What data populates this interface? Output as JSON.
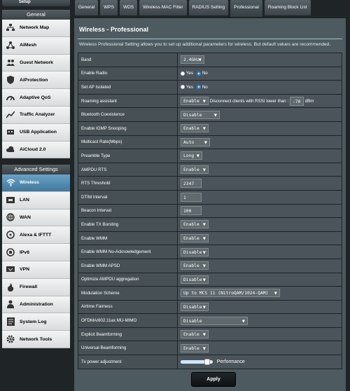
{
  "sidebar": {
    "top_button": "Setup",
    "general_header": "General",
    "general_items": [
      {
        "label": "Network Map",
        "icon": "network-map-icon"
      },
      {
        "label": "AiMesh",
        "icon": "aimesh-icon"
      },
      {
        "label": "Guest Network",
        "icon": "guest-network-icon"
      },
      {
        "label": "AiProtection",
        "icon": "shield-icon"
      },
      {
        "label": "Adaptive QoS",
        "icon": "qos-gauge-icon"
      },
      {
        "label": "Traffic Analyzer",
        "icon": "traffic-chart-icon"
      },
      {
        "label": "USB Application",
        "icon": "usb-icon"
      },
      {
        "label": "AiCloud 2.0",
        "icon": "cloud-icon"
      }
    ],
    "advanced_header": "Advanced Settings",
    "advanced_items": [
      {
        "label": "Wireless",
        "icon": "wifi-icon",
        "active": true
      },
      {
        "label": "LAN",
        "icon": "lan-icon"
      },
      {
        "label": "WAN",
        "icon": "globe-icon"
      },
      {
        "label": "Alexa & IFTTT",
        "icon": "alexa-icon"
      },
      {
        "label": "IPv6",
        "icon": "ipv6-icon"
      },
      {
        "label": "VPN",
        "icon": "vpn-icon"
      },
      {
        "label": "Firewall",
        "icon": "firewall-icon"
      },
      {
        "label": "Administration",
        "icon": "administration-icon"
      },
      {
        "label": "System Log",
        "icon": "system-log-icon"
      },
      {
        "label": "Network Tools",
        "icon": "network-tools-icon"
      }
    ]
  },
  "tabs": [
    "General",
    "WPS",
    "WDS",
    "Wireless MAC Filter",
    "RADIUS Setting",
    "Professional",
    "Roaming Block List"
  ],
  "active_tab": "Professional",
  "page": {
    "title": "Wireless - Professional",
    "description": "Wireless Professional Setting allows you to set up additional parameters for wireless. But default values are recommended.",
    "apply_label": "Apply"
  },
  "settings": {
    "band": {
      "label": "Band",
      "value": "2.4GHz"
    },
    "enable_radio": {
      "label": "Enable Radio",
      "yes": "Yes",
      "no": "No",
      "selected": "No"
    },
    "set_ap_isolated": {
      "label": "Set AP Isolated",
      "yes": "Yes",
      "no": "No",
      "selected": "No"
    },
    "roaming_assistant": {
      "label": "Roaming assistant",
      "value": "Enable",
      "text": "Disconnect clients with RSSI lower than :",
      "rssi": "-70",
      "unit": "dBm"
    },
    "bluetooth_coexistence": {
      "label": "Bluetooth Coexistence",
      "value": "Disable"
    },
    "igmp_snooping": {
      "label": "Enable IGMP Snooping",
      "value": "Enable"
    },
    "multicast_rate": {
      "label": "Multicast Rate(Mbps)",
      "value": "Auto"
    },
    "preamble_type": {
      "label": "Preamble Type",
      "value": "Long"
    },
    "ampdu_rts": {
      "label": "AMPDU RTS",
      "value": "Enable"
    },
    "rts_threshold": {
      "label": "RTS Threshold",
      "value": "2347"
    },
    "dtim_interval": {
      "label": "DTIM Interval",
      "value": "1"
    },
    "beacon_interval": {
      "label": "Beacon Interval",
      "value": "100"
    },
    "tx_bursting": {
      "label": "Enable TX Bursting",
      "value": "Enable"
    },
    "wmm": {
      "label": "Enable WMM",
      "value": "Enable"
    },
    "wmm_no_ack": {
      "label": "Enable WMM No-Acknowledgement",
      "value": "Disable"
    },
    "wmm_apsd": {
      "label": "Enable WMM APSD",
      "value": "Enable"
    },
    "ampdu_aggregation": {
      "label": "Optimize AMPDU aggregation",
      "value": "Disable"
    },
    "modulation_scheme": {
      "label": "Modulation Scheme",
      "value": "Up to MCS 11 (NitroQAM/1024-QAM)"
    },
    "airtime_fairness": {
      "label": "Airtime Fairness",
      "value": "Disable"
    },
    "ofdma": {
      "label": "OFDMA/802.11ax MU-MIMO",
      "value": "Disable"
    },
    "explicit_beamforming": {
      "label": "Explicit Beamforming",
      "value": "Enable"
    },
    "universal_beamforming": {
      "label": "Universal Beamforming",
      "value": "Enable"
    },
    "tx_power": {
      "label": "Tx power adjustment",
      "value_text": "Performance",
      "level_percent": 90
    }
  },
  "colors": {
    "accent": "#2f8de0",
    "panel": "#4d5a5f",
    "active_item": "#4f88b0"
  }
}
